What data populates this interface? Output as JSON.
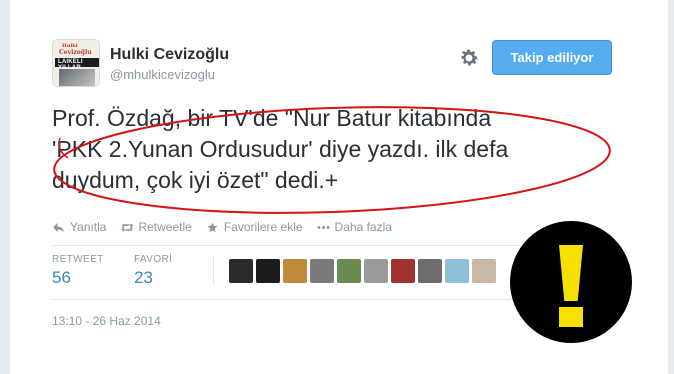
{
  "user": {
    "name": "Hulki Cevizoğlu",
    "handle": "@mhulkicevizoglu",
    "avatar_text": [
      "Hulki",
      "Cevizoğlu",
      "LAIKELI YILLAR"
    ]
  },
  "follow_button": {
    "label": "Takip ediliyor",
    "color": "#55acee"
  },
  "tweet": {
    "lines": [
      "Prof. Özdağ, bir TV'de \"Nur Batur kitabında",
      "'PKK 2.Yunan Ordusudur' diye yazdı. ilk defa",
      "duydum, çok iyi özet\" dedi.+"
    ],
    "highlight_color": "#d41414"
  },
  "actions": [
    {
      "icon": "reply-icon",
      "label": "Yanıtla"
    },
    {
      "icon": "retweet-icon",
      "label": "Retweetle"
    },
    {
      "icon": "star-icon",
      "label": "Favorilere ekle"
    },
    {
      "icon": "more-icon",
      "label": "Daha fazla"
    }
  ],
  "stats": {
    "retweet": {
      "label": "RETWEET",
      "value": "56"
    },
    "favori": {
      "label": "FAVORİ",
      "value": "23"
    }
  },
  "favoriters_colors": [
    "#2a2a2a",
    "#1c1c1c",
    "#c08a3a",
    "#7a7a7a",
    "#6b8b4e",
    "#9a9a9a",
    "#a13232",
    "#6d6d6d",
    "#8fbfd9",
    "#c9b8a6"
  ],
  "timestamp": "13:10 - 26 Haz 2014",
  "warning_icon": {
    "name": "exclamation-warning-icon",
    "bg": "#000000",
    "fg": "#f5e000"
  }
}
